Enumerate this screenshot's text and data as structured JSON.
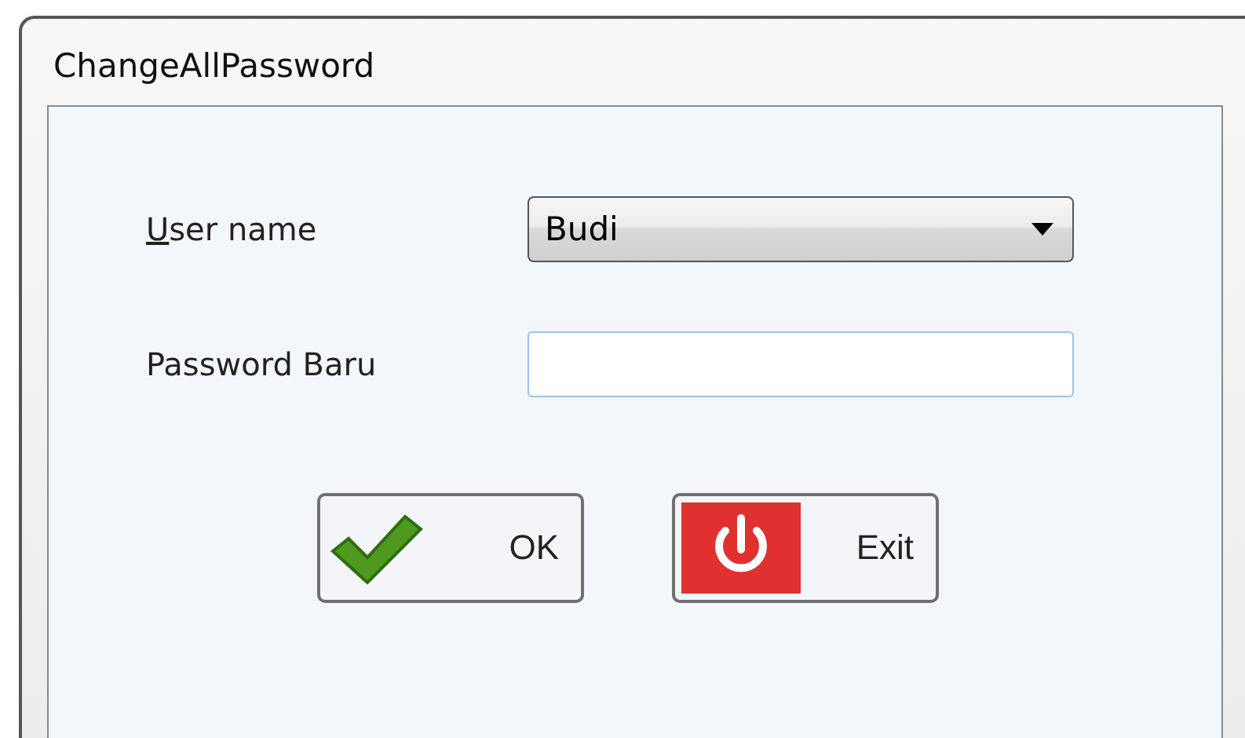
{
  "window": {
    "title": "ChangeAllPassword"
  },
  "fields": [
    {
      "kind": "dropdown",
      "label": "User name",
      "access_key_underlined": true,
      "value": "Budi"
    },
    {
      "kind": "text",
      "label": "Password Baru",
      "access_key_underlined": false,
      "focused": true
    }
  ],
  "buttons": [
    {
      "kind": "ok",
      "label": "OK"
    },
    {
      "kind": "exit",
      "label": "Exit"
    }
  ]
}
